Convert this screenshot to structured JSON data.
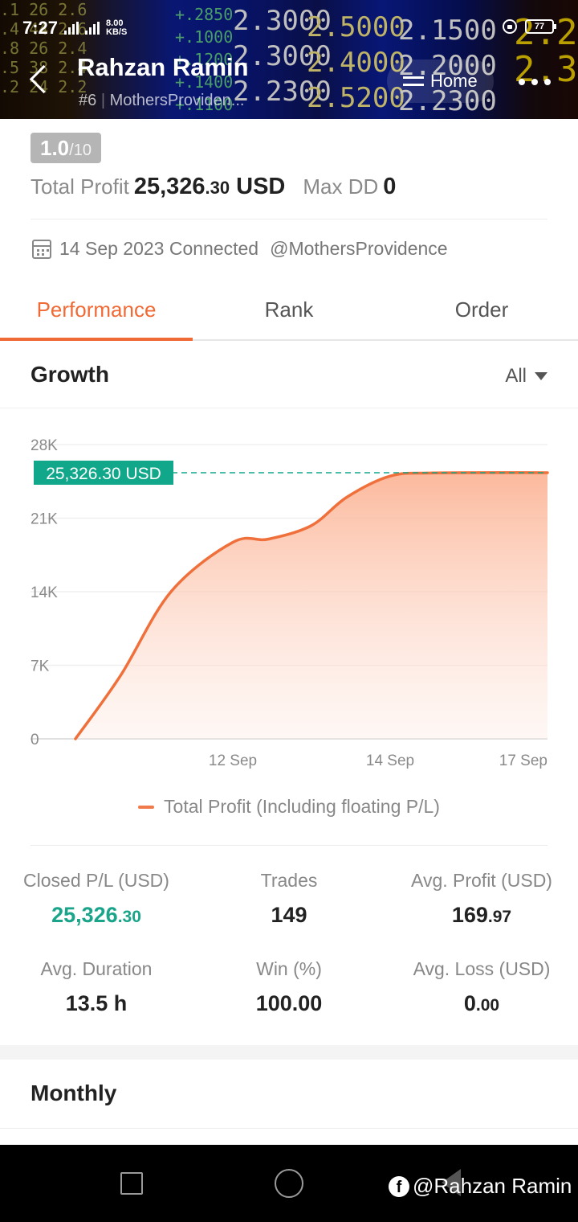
{
  "status_bar": {
    "time": "7:27",
    "network": "8.00",
    "network_unit": "KB/S",
    "battery": "77"
  },
  "header": {
    "name": "Rahzan Ramin",
    "rank_tag": "#6",
    "separator": "|",
    "handle_short": "MothersProviden...",
    "home_label": "Home"
  },
  "summary": {
    "rating": "1.0",
    "rating_max": "/10",
    "total_profit_label": "Total Profit",
    "total_profit_int": "25,326",
    "total_profit_dec": ".30",
    "total_profit_unit": "USD",
    "max_dd_label": "Max DD",
    "max_dd": "0",
    "connected_text": "14 Sep 2023 Connected",
    "handle": "@MothersProvidence"
  },
  "tabs": [
    {
      "label": "Performance",
      "active": true
    },
    {
      "label": "Rank",
      "active": false
    },
    {
      "label": "Order",
      "active": false
    }
  ],
  "growth": {
    "title": "Growth",
    "range": "All"
  },
  "chart_data": {
    "type": "area",
    "y_ticks": [
      "28K",
      "21K",
      "14K",
      "7K",
      "0"
    ],
    "ylim": [
      0,
      28000
    ],
    "x_ticks": [
      "12 Sep",
      "14 Sep",
      "17 Sep"
    ],
    "current_value_label": "25,326.30 USD",
    "current_value": 25326.3,
    "series": [
      {
        "name": "Total Profit (Including floating P/L)",
        "points": [
          {
            "x": "10 Sep",
            "y": 0
          },
          {
            "x": "11 Sep",
            "y": 6000
          },
          {
            "x": "11 Sep",
            "y": 14000
          },
          {
            "x": "12 Sep",
            "y": 18700
          },
          {
            "x": "12 Sep",
            "y": 19000
          },
          {
            "x": "13 Sep",
            "y": 20300
          },
          {
            "x": "13 Sep",
            "y": 23000
          },
          {
            "x": "14 Sep",
            "y": 25000
          },
          {
            "x": "15 Sep",
            "y": 25300
          },
          {
            "x": "17 Sep",
            "y": 25326.3
          }
        ]
      }
    ],
    "colors": {
      "line": "#f0703c",
      "label_bg": "#11a78a"
    }
  },
  "stats": [
    {
      "label": "Closed P/L (USD)",
      "int": "25,326",
      "dec": ".30",
      "green": true
    },
    {
      "label": "Trades",
      "int": "149",
      "dec": "",
      "green": false
    },
    {
      "label": "Avg. Profit (USD)",
      "int": "169",
      "dec": ".97",
      "green": false
    },
    {
      "label": "Avg. Duration",
      "int": "13.5 h",
      "dec": "",
      "green": false
    },
    {
      "label": "Win (%)",
      "int": "100.00",
      "dec": "",
      "green": false
    },
    {
      "label": "Avg. Loss (USD)",
      "int": "0",
      "dec": ".00",
      "green": false
    }
  ],
  "monthly": {
    "title": "Monthly"
  },
  "watermark": {
    "text": "@Rahzan Ramin"
  }
}
